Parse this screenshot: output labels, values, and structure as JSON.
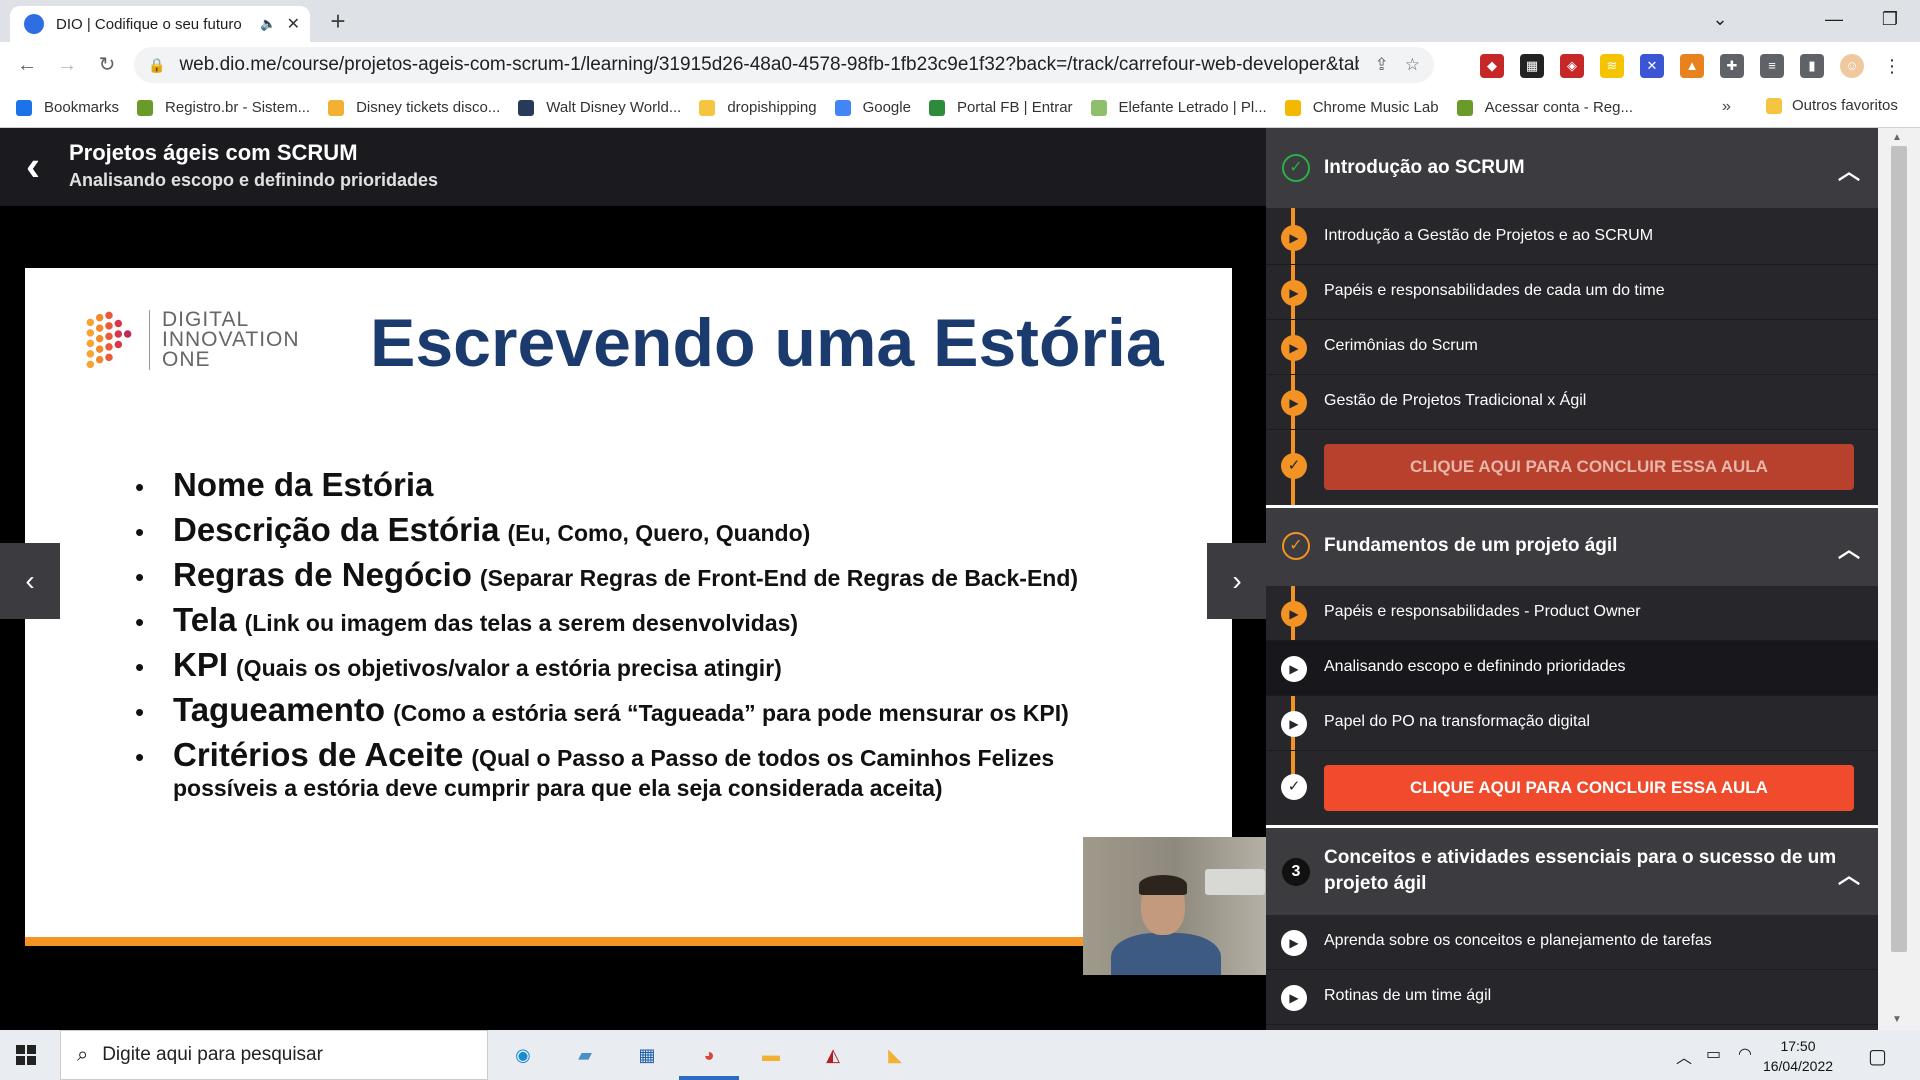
{
  "browser": {
    "tab_title": "DIO | Codifique o seu futuro",
    "url": "web.dio.me/course/projetos-ageis-com-scrum-1/learning/31915d26-48a0-4578-98fb-1fb23c9e1f32?back=/track/carrefour-web-developer&tab=undefin...",
    "bookmarks": [
      {
        "label": "Bookmarks",
        "color": "#1a73e8"
      },
      {
        "label": "Registro.br - Sistem...",
        "color": "#6a9a2a"
      },
      {
        "label": "Disney tickets disco...",
        "color": "#f2b134"
      },
      {
        "label": "Walt Disney World...",
        "color": "#283a5a"
      },
      {
        "label": "dropishipping",
        "color": "#f5c542"
      },
      {
        "label": "Google",
        "color": "#4285f4"
      },
      {
        "label": "Portal FB | Entrar",
        "color": "#2e8b3c"
      },
      {
        "label": "Elefante Letrado | Pl...",
        "color": "#8fbf6a"
      },
      {
        "label": "Chrome Music Lab",
        "color": "#f2b900"
      },
      {
        "label": "Acessar conta - Reg...",
        "color": "#6a9a2a"
      }
    ],
    "bookmarks_more": "»",
    "other_bookmarks": "Outros favoritos"
  },
  "course": {
    "title": "Projetos ágeis com SCRUM",
    "lesson": "Analisando escopo e definindo prioridades"
  },
  "slide": {
    "logo_text_1": "DIGITAL",
    "logo_text_2": "INNOVATION",
    "logo_text_3": "ONE",
    "title": "Escrevendo uma Estória",
    "bullets": [
      {
        "main": "Nome da Estória",
        "sub": ""
      },
      {
        "main": "Descrição da Estória",
        "sub": "(Eu, Como, Quero, Quando)"
      },
      {
        "main": "Regras de Negócio",
        "sub": "(Separar Regras de Front-End de Regras de Back-End)"
      },
      {
        "main": "Tela",
        "sub": "(Link ou imagem das telas a serem desenvolvidas)"
      },
      {
        "main": "KPI",
        "sub": "(Quais os objetivos/valor a estória precisa atingir)"
      },
      {
        "main": "Tagueamento",
        "sub": "(Como a estória será “Tagueada” para pode mensurar os KPI)"
      },
      {
        "main": "Critérios de Aceite",
        "sub": "(Qual o Passo a Passo de todos os Caminhos Felizes"
      }
    ],
    "bullet_continuation": "possíveis a estória deve cumprir para que ela seja considerada aceita)"
  },
  "sidebar": {
    "modules": [
      {
        "title": "Introdução ao SCRUM",
        "status": "complete",
        "items": [
          "Introdução a Gestão de Projetos e ao SCRUM",
          "Papéis e responsabilidades de cada um do time",
          "Cerimônias do Scrum",
          "Gestão de Projetos Tradicional x Ágil"
        ],
        "button": "CLIQUE AQUI PARA CONCLUIR ESSA AULA"
      },
      {
        "title": "Fundamentos de um projeto ágil",
        "status": "in-progress",
        "items": [
          "Papéis e responsabilidades - Product Owner",
          "Analisando escopo e definindo prioridades",
          "Papel do PO na transformação digital"
        ],
        "button": "CLIQUE AQUI PARA CONCLUIR ESSA AULA"
      },
      {
        "number": "3",
        "title_line1": "Conceitos e atividades essenciais para o sucesso de um",
        "title_line2": "projeto ágil",
        "items": [
          "Aprenda sobre os conceitos e planejamento de tarefas",
          "Rotinas de um time ágil"
        ]
      }
    ]
  },
  "taskbar": {
    "search_placeholder": "Digite aqui para pesquisar",
    "time": "17:50",
    "date": "16/04/2022"
  },
  "colors": {
    "accent_orange": "#f39324",
    "button_dim": "#b8412e",
    "button_active": "#ef4b2c",
    "slide_title_blue": "#1b3b6f"
  }
}
